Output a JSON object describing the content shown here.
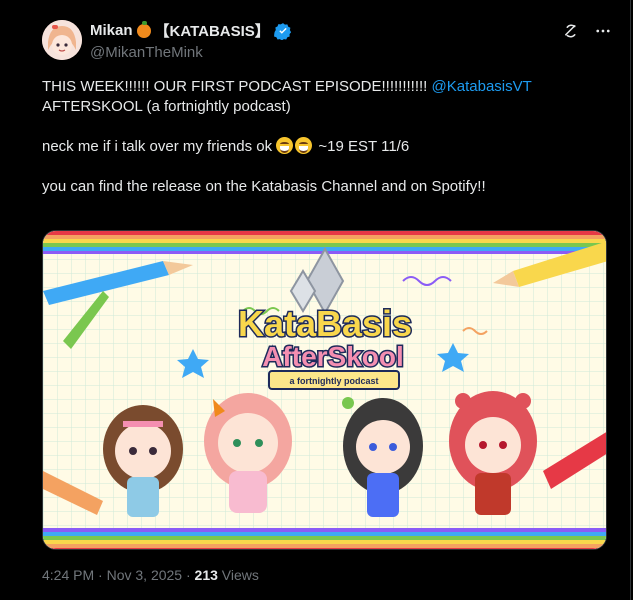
{
  "author": {
    "display_name": "Mikan",
    "name_suffix": "【KATABASIS】",
    "handle": "@MikanTheMink",
    "verified_icon": "verified-badge-icon",
    "emoji_icon": "tangerine-icon"
  },
  "tweet": {
    "line1_text": "THIS WEEK!!!!!! OUR FIRST PODCAST EPISODE!!!!!!!!!!! ",
    "line1_mention": "@KatabasisVT",
    "line2": "AFTERSKOOL (a fortnightly podcast)",
    "line3_text": "neck me if i talk over my friends ok",
    "line3_suffix": " ~19 EST 11/6",
    "line4": "you can find the release on the Katabasis Channel and on Spotify!!"
  },
  "image": {
    "title_line1": "KataBasis",
    "title_line2": "AfterSkool",
    "ribbon": "a fortnightly podcast"
  },
  "meta": {
    "time": "4:24 PM",
    "separator1": " · ",
    "date": "Nov 3, 2025",
    "separator2": " · ",
    "views_count": "213",
    "views_label": " Views"
  },
  "colors": {
    "accent": "#1d9bf0",
    "text": "#e7e9ea",
    "muted": "#71767b"
  }
}
